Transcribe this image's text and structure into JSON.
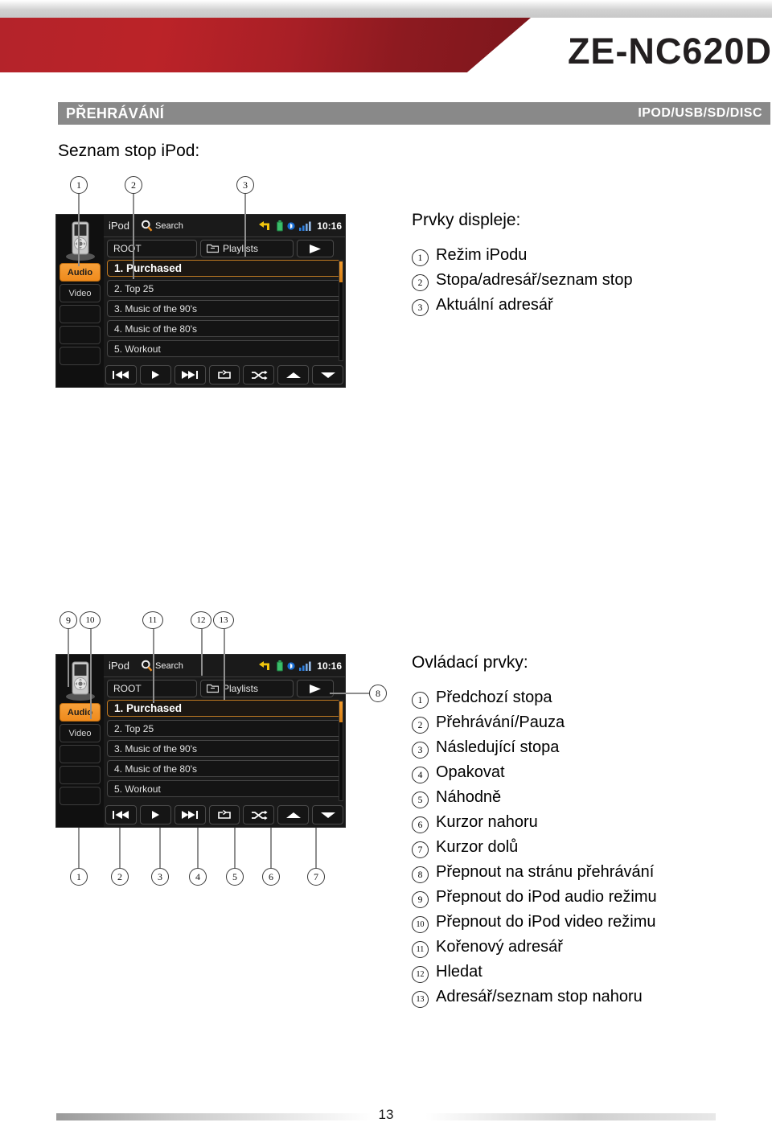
{
  "header": {
    "model": "ZE-NC620D",
    "section_left": "PŘEHRÁVÁNÍ",
    "section_right": "IPOD/USB/SD/DISC",
    "brand_red": "#b4232a",
    "section_bar_gray": "#898989"
  },
  "subtitle": "Seznam stop iPod:",
  "device_screen": {
    "status": {
      "source_label": "iPod",
      "search_label": "Search",
      "time": "10:16",
      "nav_icon": "navigation-arrow-icon",
      "battery_icon": "battery-icon",
      "bluetooth_icon": "bluetooth-icon",
      "signal_icon": "signal-bars-icon"
    },
    "sidebar": {
      "device_icon": "ipod-device-icon",
      "buttons": [
        {
          "label": "Audio",
          "active": true
        },
        {
          "label": "Video",
          "active": false
        },
        {
          "label": "",
          "active": false
        },
        {
          "label": "",
          "active": false
        },
        {
          "label": "",
          "active": false
        }
      ]
    },
    "nav_row": {
      "root_label": "ROOT",
      "playlists_label": "Playlists",
      "playlists_icon": "folder-icon",
      "play_icon": "play-icon"
    },
    "list_rows": [
      {
        "label": "1. Purchased",
        "selected": true
      },
      {
        "label": "2. Top 25",
        "selected": false
      },
      {
        "label": "3. Music of the 90's",
        "selected": false
      },
      {
        "label": "4. Music of the 80's",
        "selected": false
      },
      {
        "label": "5. Workout",
        "selected": false
      }
    ],
    "controls": [
      "previous-track-icon",
      "play-icon",
      "next-track-icon",
      "repeat-icon",
      "shuffle-icon",
      "cursor-up-icon",
      "cursor-down-icon"
    ]
  },
  "callouts_top_1": [
    "1",
    "2",
    "3"
  ],
  "callouts_top_2": [
    "9",
    "10",
    "11",
    "12",
    "13"
  ],
  "callouts_bottom_2": [
    "1",
    "2",
    "3",
    "4",
    "5",
    "6",
    "7"
  ],
  "callout_right_2": "8",
  "display_panel": {
    "title": "Prvky displeje:",
    "items": [
      {
        "num": "1",
        "label": "Režim iPodu"
      },
      {
        "num": "2",
        "label": "Stopa/adresář/seznam stop"
      },
      {
        "num": "3",
        "label": "Aktuální adresář"
      }
    ]
  },
  "controls_panel": {
    "title": "Ovládací prvky:",
    "items": [
      {
        "num": "1",
        "label": "Předchozí stopa"
      },
      {
        "num": "2",
        "label": "Přehrávání/Pauza"
      },
      {
        "num": "3",
        "label": "Následující stopa"
      },
      {
        "num": "4",
        "label": "Opakovat"
      },
      {
        "num": "5",
        "label": "Náhodně"
      },
      {
        "num": "6",
        "label": "Kurzor nahoru"
      },
      {
        "num": "7",
        "label": "Kurzor dolů"
      },
      {
        "num": "8",
        "label": "Přepnout na stránu přehrávání"
      },
      {
        "num": "9",
        "label": "Přepnout do iPod audio režimu"
      },
      {
        "num": "10",
        "label": "Přepnout do iPod video režimu"
      },
      {
        "num": "11",
        "label": "Kořenový adresář"
      },
      {
        "num": "12",
        "label": "Hledat"
      },
      {
        "num": "13",
        "label": "Adresář/seznam stop nahoru"
      }
    ]
  },
  "footer": {
    "page_number": "13"
  }
}
